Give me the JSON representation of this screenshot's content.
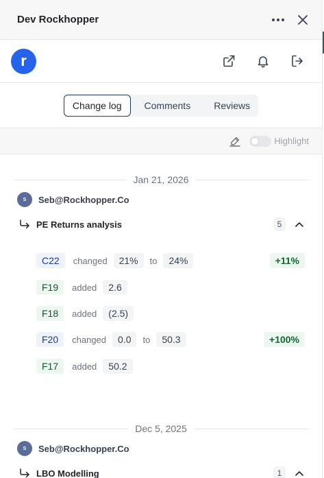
{
  "header": {
    "title": "Dev Rockhopper"
  },
  "toolbar": {
    "logo_letter": "r"
  },
  "tabs": [
    {
      "label": "Change log",
      "active": true
    },
    {
      "label": "Comments",
      "active": false
    },
    {
      "label": "Reviews",
      "active": false
    }
  ],
  "highlight": {
    "label": "Highlight",
    "enabled": false
  },
  "log": [
    {
      "date": "Jan 21, 2026",
      "user": {
        "initials": "S",
        "name": "Seb@Rockhopper.Co"
      },
      "group": {
        "name": "PE Returns analysis",
        "count": "5"
      },
      "changes": [
        {
          "cell": "C22",
          "action": "changed",
          "from": "21%",
          "to_word": "to",
          "to": "24%",
          "delta": "+11%"
        },
        {
          "cell": "F19",
          "action": "added",
          "value": "2.6"
        },
        {
          "cell": "F18",
          "action": "added",
          "value": "(2.5)"
        },
        {
          "cell": "F20",
          "action": "changed",
          "from": "0.0",
          "to_word": "to",
          "to": "50.3",
          "delta": "+100%"
        },
        {
          "cell": "F17",
          "action": "added",
          "value": "50.2"
        }
      ]
    },
    {
      "date": "Dec 5, 2025",
      "user": {
        "initials": "S",
        "name": "Seb@Rockhopper.Co"
      },
      "group": {
        "name": "LBO Modelling",
        "count": "1"
      }
    }
  ],
  "colors": {
    "accent": "#2563eb",
    "changed_bg": "#eef2fb",
    "added_bg": "#ecf7ef",
    "delta_text": "#166534"
  }
}
